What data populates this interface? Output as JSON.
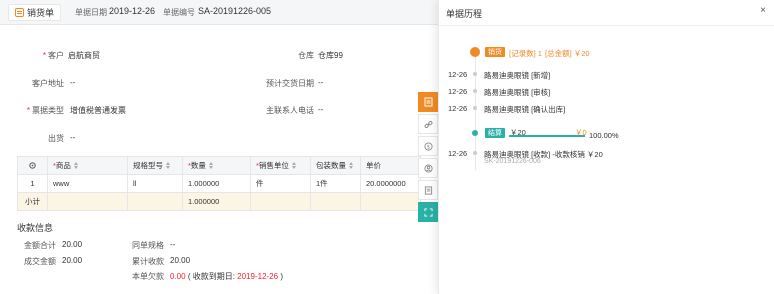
{
  "header": {
    "tab_label": "销货单",
    "date_label": "单据日期",
    "date_value": "2019-12-26",
    "no_label": "单据编号",
    "no_value": "SA-20191226-005"
  },
  "form": {
    "customer_label": "客户",
    "customer_value": "启航商贸",
    "warehouse_label": "仓库",
    "warehouse_value": "仓库99",
    "address_label": "客户地址",
    "address_value": "--",
    "expected_date_label": "预计交货日期",
    "expected_date_value": "--",
    "invoice_label": "票据类型",
    "invoice_value": "增值税普通发票",
    "contact_label": "主联系人电话",
    "contact_value": "--",
    "shipping_label": "出货",
    "shipping_value": "--"
  },
  "table": {
    "headers": [
      "",
      "商品",
      "规格型号",
      "数量",
      "销售单位",
      "包装数量",
      "单价"
    ],
    "row": [
      "1",
      "www",
      "ll",
      "1.000000",
      "件",
      "1件",
      "20.0000000"
    ],
    "total_label": "小计",
    "total_qty": "1.000000"
  },
  "payment": {
    "section_title": "收款信息",
    "amount_total_label": "金额合计",
    "amount_total_value": "20.00",
    "deal_amount_label": "成交金额",
    "deal_amount_value": "20.00",
    "same_spec_label": "同单规格",
    "same_spec_value": "--",
    "cumulative_label": "累计收款",
    "cumulative_value": "20.00",
    "owed_label": "本单欠款",
    "owed_value": "0.00",
    "owed_note_prefix": "( 收款到期日:",
    "owed_note_date": "2019-12-26",
    "owed_note_suffix": ")"
  },
  "history": {
    "title": "单据历程",
    "close": "×",
    "summary_tag": "销货",
    "summary_text": "[记录数] 1",
    "summary_amount": "[总金额] ￥20",
    "events": [
      {
        "date": "12-26",
        "text": "路易迪奥眼镜 [新增]"
      },
      {
        "date": "12-26",
        "text": "路易迪奥眼镜 [审核]"
      },
      {
        "date": "12-26",
        "text": "路易迪奥眼镜 [确认出库]"
      }
    ],
    "settle_tag": "结算",
    "settle_amount": "￥20",
    "settle_remaining": "￥0",
    "settle_percent": "100.00%",
    "settle_progress": 1.0,
    "receipt_date": "12-26",
    "receipt_text": "路易迪奥眼镜 [收款] -收款核销 ￥20",
    "receipt_no": "SK-20191226-006"
  },
  "colors": {
    "accent": "#f08a24",
    "teal": "#2ab1a5",
    "required": "#f5222d"
  }
}
